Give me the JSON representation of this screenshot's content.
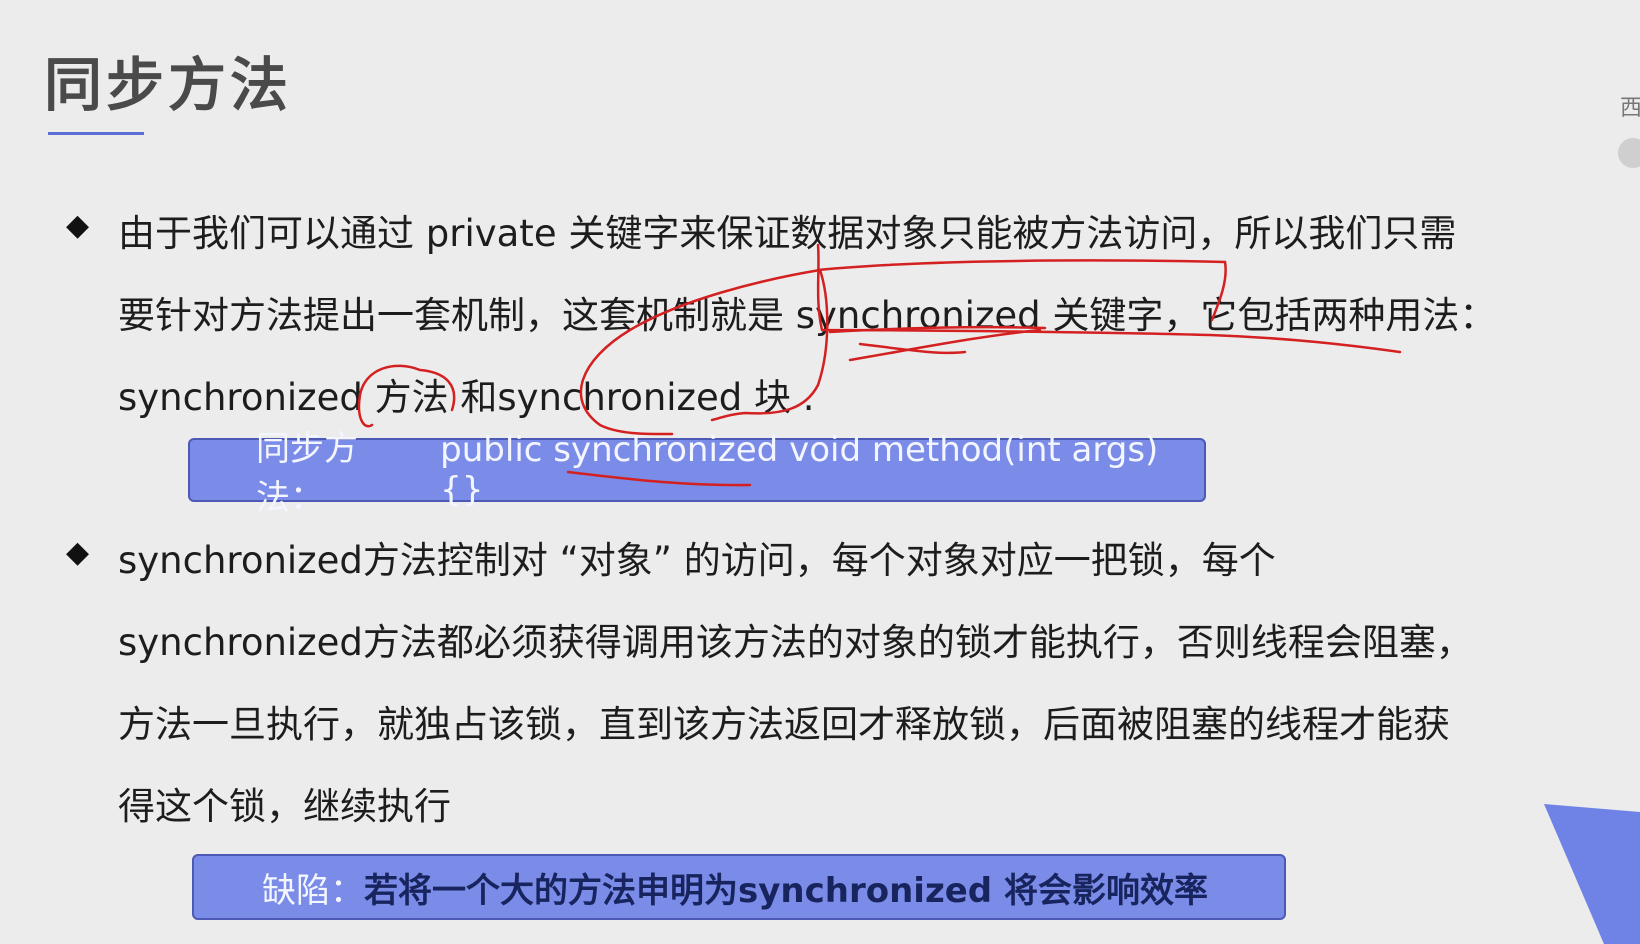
{
  "slide": {
    "title": "同步方法",
    "bullet_symbol": "◆",
    "bullet1": {
      "lines": [
        "由于我们可以通过 private 关键字来保证数据对象只能被方法访问，所以我们只需",
        "要针对方法提出一套机制，这套机制就是 synchronized 关键字，它包括两种用法：",
        "synchronized 方法 和synchronized 块 ."
      ]
    },
    "box1": {
      "label": "同步方法：",
      "code": "public synchronized void method(int args) {}"
    },
    "bullet2": {
      "lines": [
        "synchronized方法控制对 “对象” 的访问，每个对象对应一把锁，每个",
        "synchronized方法都必须获得调用该方法的对象的锁才能执行，否则线程会阻塞，",
        "方法一旦执行，就独占该锁，直到该方法返回才释放锁，后面被阻塞的线程才能获",
        "得这个锁，继续执行"
      ]
    },
    "box2": {
      "label": "缺陷：",
      "text": "若将一个大的方法申明为synchronized 将会影响效率"
    },
    "side_label": "西"
  },
  "colors": {
    "accent": "#7b8ce8",
    "annotation_ink": "#d42020",
    "title_underline": "#5b6fd6"
  }
}
